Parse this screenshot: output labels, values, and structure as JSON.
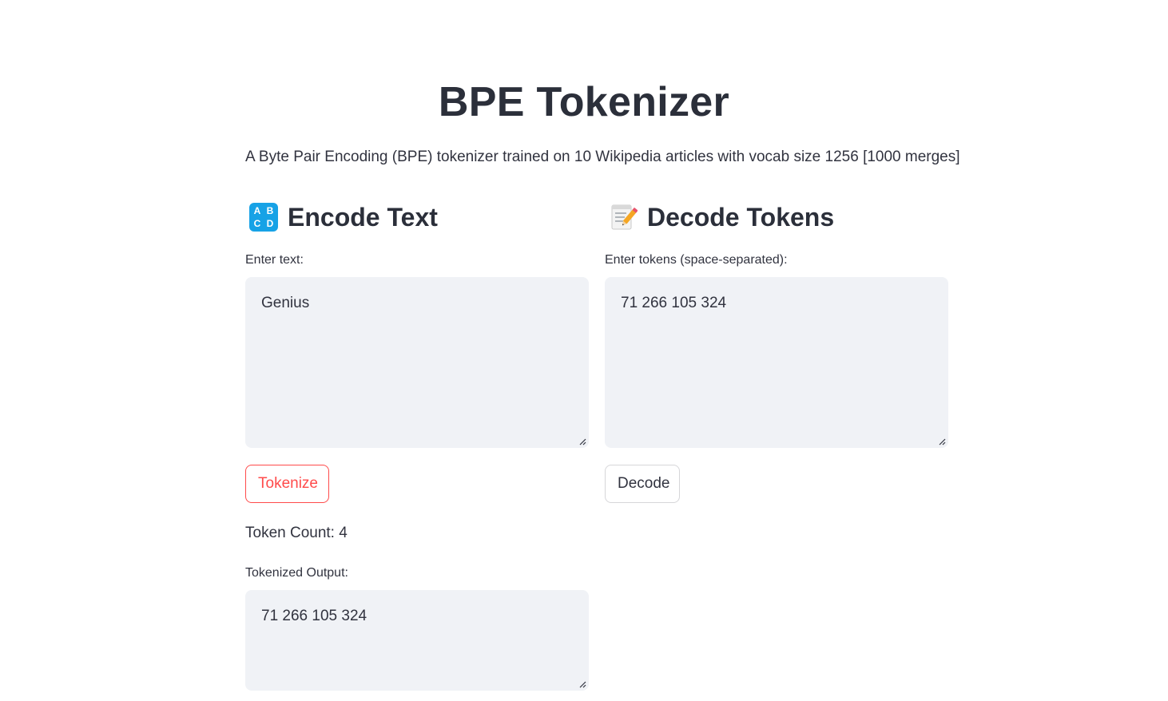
{
  "header": {
    "title": "BPE Tokenizer",
    "subtitle": "A Byte Pair Encoding (BPE) tokenizer trained on 10 Wikipedia articles with vocab size 1256 [1000 merges]"
  },
  "encode": {
    "icon": "abcd-icon",
    "icon_letters": [
      "A",
      "B",
      "C",
      "D"
    ],
    "heading": "Encode Text",
    "input_label": "Enter text:",
    "input_value": "Genius",
    "button_label": "Tokenize",
    "token_count_text": "Token Count: 4",
    "output_label": "Tokenized Output:",
    "output_value": "71 266 105 324"
  },
  "decode": {
    "icon": "memo-icon",
    "heading": "Decode Tokens",
    "input_label": "Enter tokens (space-separated):",
    "input_value": "71 266 105 324",
    "button_label": "Decode"
  },
  "colors": {
    "accent": "#ff4b4b",
    "textarea_bg": "#f0f2f6",
    "icon_blue": "#17a2e6"
  }
}
